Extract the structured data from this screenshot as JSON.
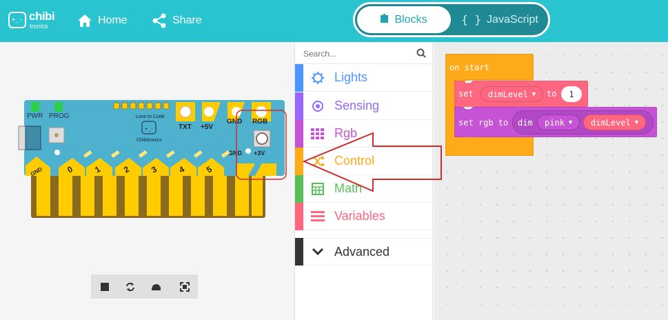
{
  "header": {
    "logo_main": "chibi",
    "logo_sub": "tronics",
    "logo_face": "+_-",
    "nav": {
      "home": "Home",
      "share": "Share"
    },
    "toggle": {
      "blocks": "Blocks",
      "javascript": "JavaScript",
      "js_icon": "{ }"
    },
    "colors": {
      "bar": "#2ac4d0",
      "toggle": "#1f8a93"
    }
  },
  "board": {
    "labels": {
      "pwr": "PWR",
      "prog": "PROG",
      "txt": "TXT",
      "v5": "+5V",
      "gnd_top": "GND",
      "rgb": "RGB",
      "gnd_right": "GND",
      "v3": "+3V",
      "gnd_left": "GND"
    },
    "logo_text": "Love to Code",
    "logo_name": "Chibitronics",
    "logo_face": "+_-",
    "pins": [
      "0",
      "1",
      "2",
      "3",
      "4",
      "5"
    ]
  },
  "sim_toolbar": {
    "icons": [
      "stop-icon",
      "restart-icon",
      "slow-motion-icon",
      "fullscreen-icon"
    ]
  },
  "toolbox": {
    "search_placeholder": "Search...",
    "categories": [
      {
        "label": "Lights",
        "color": "#4c97ff",
        "icon": "lightbulb-icon"
      },
      {
        "label": "Sensing",
        "color": "#9966ff",
        "icon": "radio-target-icon"
      },
      {
        "label": "Rgb",
        "color": "#c653d6",
        "icon": "grid-icon"
      },
      {
        "label": "Control",
        "color": "#ffab19",
        "icon": "shuffle-icon"
      },
      {
        "label": "Math",
        "color": "#59c059",
        "icon": "calculator-icon"
      },
      {
        "label": "Variables",
        "color": "#ff6680",
        "icon": "list-icon"
      },
      {
        "label": "Advanced",
        "color": "#333333",
        "icon": "chevron-down-icon"
      }
    ]
  },
  "workspace": {
    "on_start": "on start",
    "set_block": {
      "keyword": "set",
      "variable": "dimLevel",
      "to": "to",
      "value": "1"
    },
    "rgb_block": {
      "keyword": "set rgb to",
      "dim": "dim",
      "color": "pink",
      "variable": "dimLevel"
    },
    "colors": {
      "control": "#ffab19",
      "variables": "#ff6680",
      "rgb": "#c653d6"
    }
  }
}
